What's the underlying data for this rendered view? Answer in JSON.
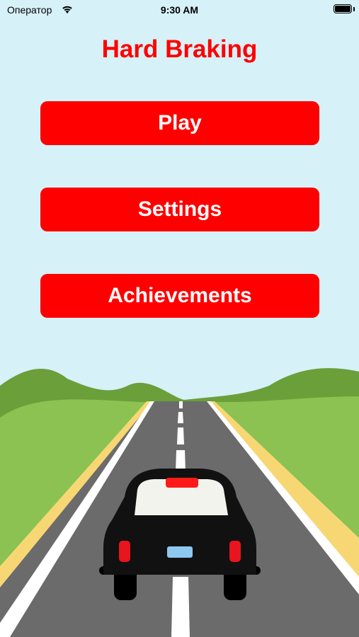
{
  "status_bar": {
    "carrier": "Оператор",
    "time": "9:30 AM",
    "wifi_icon": "wifi-icon",
    "battery_icon": "battery-icon"
  },
  "title": "Hard Braking",
  "menu": {
    "play": "Play",
    "settings": "Settings",
    "achievements": "Achievements"
  },
  "colors": {
    "accent": "#ff0000",
    "sky": "#d6f1f8",
    "grass": "#8bc252",
    "hills": "#6a9f3a",
    "road": "#6b6b6b",
    "shoulder": "#f7d774",
    "car": "#111111"
  }
}
